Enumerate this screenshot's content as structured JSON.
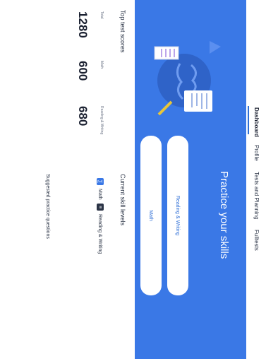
{
  "brand": "",
  "nav": {
    "items": [
      {
        "label": "Dashboard"
      },
      {
        "label": "Profile"
      },
      {
        "label": "Tests and Planning"
      },
      {
        "label": "Fulltests"
      },
      {
        "label": "",
        "muted": true
      }
    ]
  },
  "hero": {
    "kicker": "",
    "title": "Practice your skills",
    "subtitle": "",
    "rw_button": "Reading & Writing",
    "math_button": "Math"
  },
  "scores": {
    "title": "Top test scores",
    "view_all": "",
    "items": [
      {
        "label": "Total",
        "value": "1280"
      },
      {
        "label": "Math",
        "value": "600"
      },
      {
        "label": "Reading & Writing",
        "value": "680"
      }
    ]
  },
  "skills": {
    "title": "Current skill levels",
    "link": "",
    "items": [
      {
        "label": "Math"
      },
      {
        "label": "Reading & Writing"
      }
    ]
  },
  "suggest": {
    "title": "Suggested practice questions",
    "line1": "",
    "line2": ""
  },
  "colors": {
    "accent": "#3a78e6",
    "nav_underline": "#2f6fd6",
    "text_dark": "#1a2030"
  }
}
